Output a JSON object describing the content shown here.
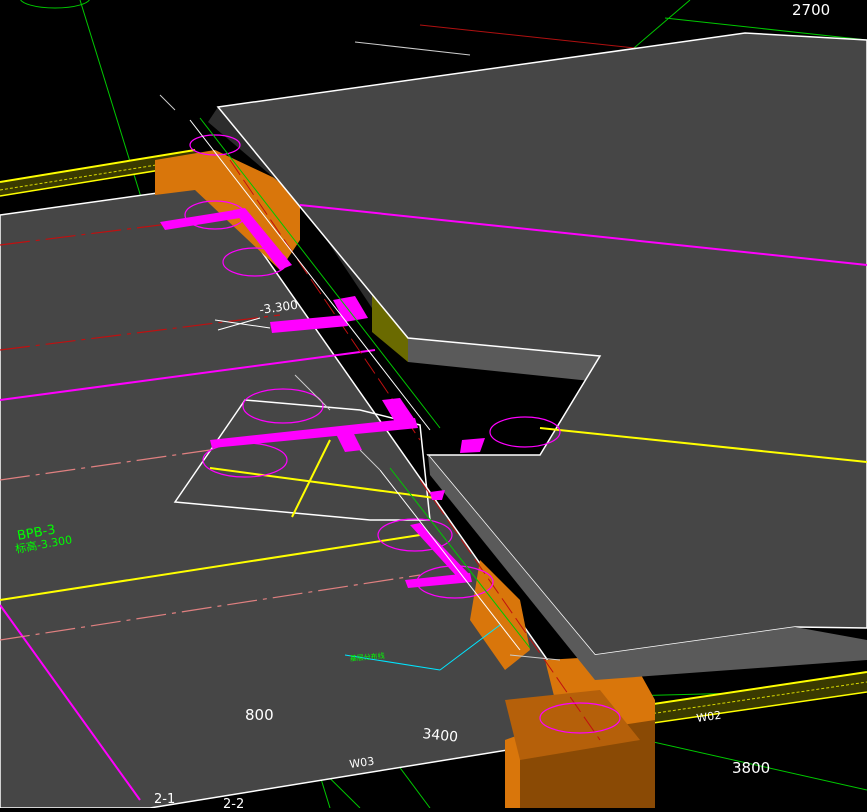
{
  "viewport": {
    "dimension_labels": {
      "d2700": "2700",
      "d800": "800",
      "d3400": "3400",
      "d3800": "3800"
    },
    "elevation_label": "-3.300",
    "beam_tag": {
      "name": "BPB-3",
      "level": "标高-3.300"
    },
    "note_label": "基层分布线",
    "axis_labels": {
      "a21": "2-1",
      "a22": "2-2"
    },
    "wall_labels": {
      "w02": "W02",
      "w03": "W03"
    }
  },
  "colors": {
    "background": "#000000",
    "slab": "#464646",
    "slab_edge": "#5a5a5a",
    "beam": "#d9760b",
    "beam_dark": "#8a4a05",
    "magenta": "#ff00ff",
    "yellow": "#ffff00",
    "green": "#00ff00",
    "cyan": "#00e5ff",
    "red": "#c01010",
    "white": "#ffffff"
  }
}
